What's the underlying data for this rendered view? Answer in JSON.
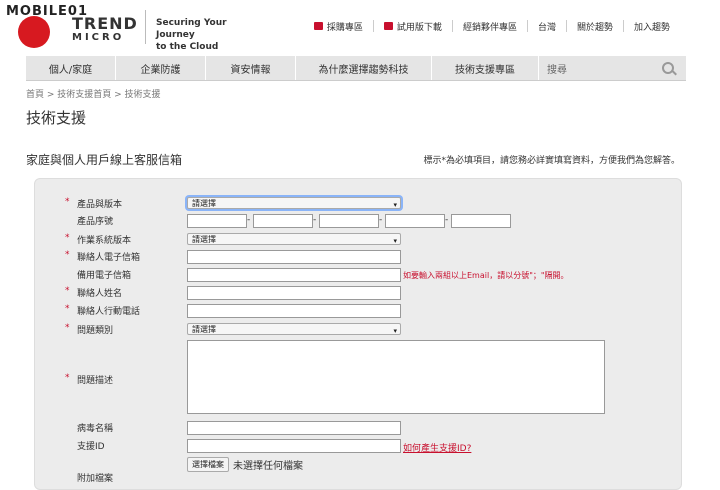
{
  "brand": {
    "watermark": "MOBILE01",
    "logo_name": "TREND",
    "logo_sub": "MICRO",
    "tagline_line1": "Securing Your Journey",
    "tagline_line2": "to the Cloud"
  },
  "top_links": [
    "採購專區",
    "試用版下載",
    "經銷夥伴專區",
    "台灣",
    "關於趨勢",
    "加入趨勢"
  ],
  "nav": {
    "items": [
      "個人/家庭",
      "企業防護",
      "資安情報",
      "為什麼選擇趨勢科技",
      "技術支援專區"
    ],
    "search_placeholder": "搜尋"
  },
  "breadcrumb": "首頁 > 技術支援首頁 > 技術支援",
  "page_title": "技術支援",
  "section_title": "家庭與個人用戶線上客服信箱",
  "required_note": "標示*為必填項目，請您務必詳實填寫資料，方便我們為您解答。",
  "form": {
    "product_label": "產品與版本",
    "product_value": "請選擇",
    "serial_label": "產品序號",
    "os_label": "作業系統版本",
    "os_value": "請選擇",
    "email_label": "聯絡人電子信箱",
    "backup_email_label": "備用電子信箱",
    "backup_email_note": "如要輸入兩組以上Email，請以分號\"；\"隔開。",
    "name_label": "聯絡人姓名",
    "phone_label": "聯絡人行動電話",
    "category_label": "問題類別",
    "category_value": "請選擇",
    "desc_label": "問題描述",
    "virus_label": "病毒名稱",
    "support_id_label": "支援ID",
    "support_id_help": "如何產生支援ID?",
    "file_button": "選擇檔案",
    "file_status": "未選擇任何檔案",
    "attach_label": "附加檔案",
    "required_mark": "*"
  }
}
